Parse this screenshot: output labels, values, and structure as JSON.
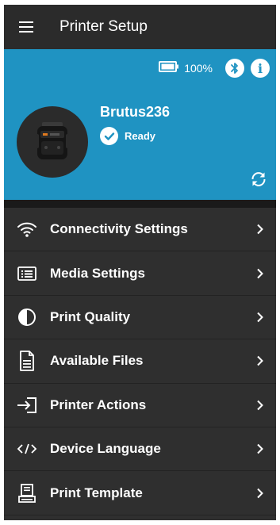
{
  "appbar": {
    "title": "Printer Setup"
  },
  "status": {
    "battery_percent": "100%"
  },
  "printer": {
    "name": "Brutus236",
    "status": "Ready"
  },
  "menu": [
    {
      "label": "Connectivity Settings",
      "icon": "wifi-icon"
    },
    {
      "label": "Media Settings",
      "icon": "media-list-icon"
    },
    {
      "label": "Print Quality",
      "icon": "contrast-icon"
    },
    {
      "label": "Available Files",
      "icon": "document-icon"
    },
    {
      "label": "Printer Actions",
      "icon": "enter-arrow-icon"
    },
    {
      "label": "Device Language",
      "icon": "code-icon"
    },
    {
      "label": "Print Template",
      "icon": "printer-template-icon"
    }
  ],
  "colors": {
    "accent": "#1f93c2",
    "background": "#2f2f2f",
    "appbar": "#2b2b2b"
  }
}
